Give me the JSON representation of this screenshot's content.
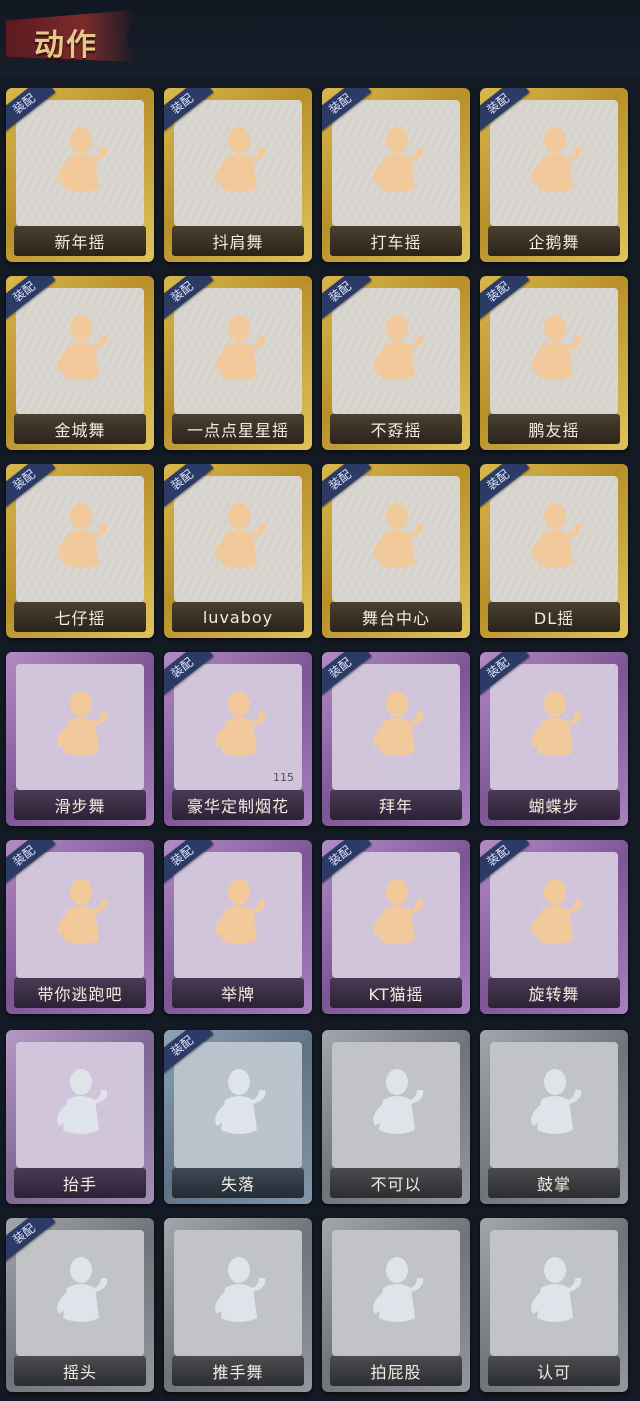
{
  "header": {
    "title": "动作"
  },
  "equip_badge": "装配",
  "cards": [
    {
      "label": "新年摇",
      "tier": "gold",
      "equipped": true,
      "icon": "dance-pose-icon"
    },
    {
      "label": "抖肩舞",
      "tier": "gold",
      "equipped": true,
      "icon": "dance-pose-icon"
    },
    {
      "label": "打车摇",
      "tier": "gold",
      "equipped": true,
      "icon": "dance-pose-icon"
    },
    {
      "label": "企鹅舞",
      "tier": "gold",
      "equipped": true,
      "icon": "dance-pose-icon"
    },
    {
      "label": "金城舞",
      "tier": "gold",
      "equipped": true,
      "icon": "dance-pose-icon"
    },
    {
      "label": "一点点星星摇",
      "tier": "gold",
      "equipped": true,
      "icon": "dance-pose-icon"
    },
    {
      "label": "不孬摇",
      "tier": "gold",
      "equipped": true,
      "icon": "dance-pose-icon"
    },
    {
      "label": "鹏友摇",
      "tier": "gold",
      "equipped": true,
      "icon": "dance-pose-icon"
    },
    {
      "label": "七仔摇",
      "tier": "gold",
      "equipped": true,
      "icon": "dance-pose-icon"
    },
    {
      "label": "luvaboy",
      "tier": "gold",
      "equipped": true,
      "icon": "dance-pose-icon"
    },
    {
      "label": "舞台中心",
      "tier": "gold",
      "equipped": true,
      "icon": "dance-pose-icon"
    },
    {
      "label": "DL摇",
      "tier": "gold",
      "equipped": true,
      "icon": "dance-pose-icon"
    },
    {
      "label": "滑步舞",
      "tier": "purple",
      "equipped": false,
      "icon": "dance-pose-icon"
    },
    {
      "label": "豪华定制烟花",
      "tier": "purple",
      "equipped": true,
      "icon": "fireworks-icon",
      "count": "115"
    },
    {
      "label": "拜年",
      "tier": "purple",
      "equipped": true,
      "icon": "bow-pose-icon"
    },
    {
      "label": "蝴蝶步",
      "tier": "purple",
      "equipped": true,
      "icon": "dance-pose-icon"
    },
    {
      "label": "带你逃跑吧",
      "tier": "purple",
      "equipped": true,
      "icon": "dance-pose-icon"
    },
    {
      "label": "举牌",
      "tier": "purple",
      "equipped": true,
      "icon": "sign-pose-icon"
    },
    {
      "label": "KT猫摇",
      "tier": "purple",
      "equipped": true,
      "icon": "dance-pose-icon"
    },
    {
      "label": "旋转舞",
      "tier": "purple",
      "equipped": true,
      "icon": "spin-pose-icon"
    },
    {
      "label": "抬手",
      "tier": "pgray",
      "equipped": false,
      "icon": "raise-hand-icon"
    },
    {
      "label": "失落",
      "tier": "blue",
      "equipped": true,
      "icon": "crawl-pose-icon"
    },
    {
      "label": "不可以",
      "tier": "gray",
      "equipped": false,
      "icon": "finger-wag-icon"
    },
    {
      "label": "鼓掌",
      "tier": "gray",
      "equipped": false,
      "icon": "clap-icon"
    },
    {
      "label": "摇头",
      "tier": "gray",
      "equipped": true,
      "icon": "head-shake-icon"
    },
    {
      "label": "推手舞",
      "tier": "gray",
      "equipped": false,
      "icon": "push-hands-icon"
    },
    {
      "label": "拍屁股",
      "tier": "gray",
      "equipped": false,
      "icon": "spank-pose-icon"
    },
    {
      "label": "认可",
      "tier": "gray",
      "equipped": false,
      "icon": "thumbs-up-icon"
    }
  ],
  "colors": {
    "gold": "#c9a23a",
    "purple": "#8f66a6",
    "blue": "#6f8396",
    "gray": "#85898e",
    "equip_badge": "#2c3b66"
  }
}
